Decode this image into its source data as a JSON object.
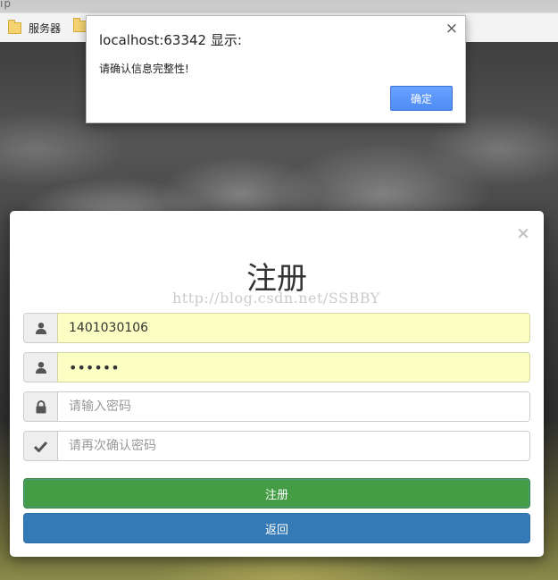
{
  "browser": {
    "partial_url_text": "ip",
    "bookmarks": [
      {
        "label": "服务器",
        "icon": "folder-icon"
      },
      {
        "label": "",
        "icon": "folder-icon"
      }
    ]
  },
  "alert": {
    "title": "localhost:63342 显示:",
    "message": "请确认信息完整性!",
    "ok_label": "确定",
    "close_glyph": "×"
  },
  "modal": {
    "close_glyph": "×",
    "title": "注册",
    "watermark": "http://blog.csdn.net/SSBBY",
    "fields": [
      {
        "icon": "user-icon",
        "value": "1401030106",
        "placeholder": "",
        "type": "text"
      },
      {
        "icon": "user-icon",
        "value": "••••••",
        "placeholder": "",
        "type": "password"
      },
      {
        "icon": "lock-icon",
        "value": "",
        "placeholder": "请输入密码",
        "type": "password"
      },
      {
        "icon": "check-icon",
        "value": "",
        "placeholder": "请再次确认密码",
        "type": "password"
      }
    ],
    "register_label": "注册",
    "back_label": "返回"
  }
}
